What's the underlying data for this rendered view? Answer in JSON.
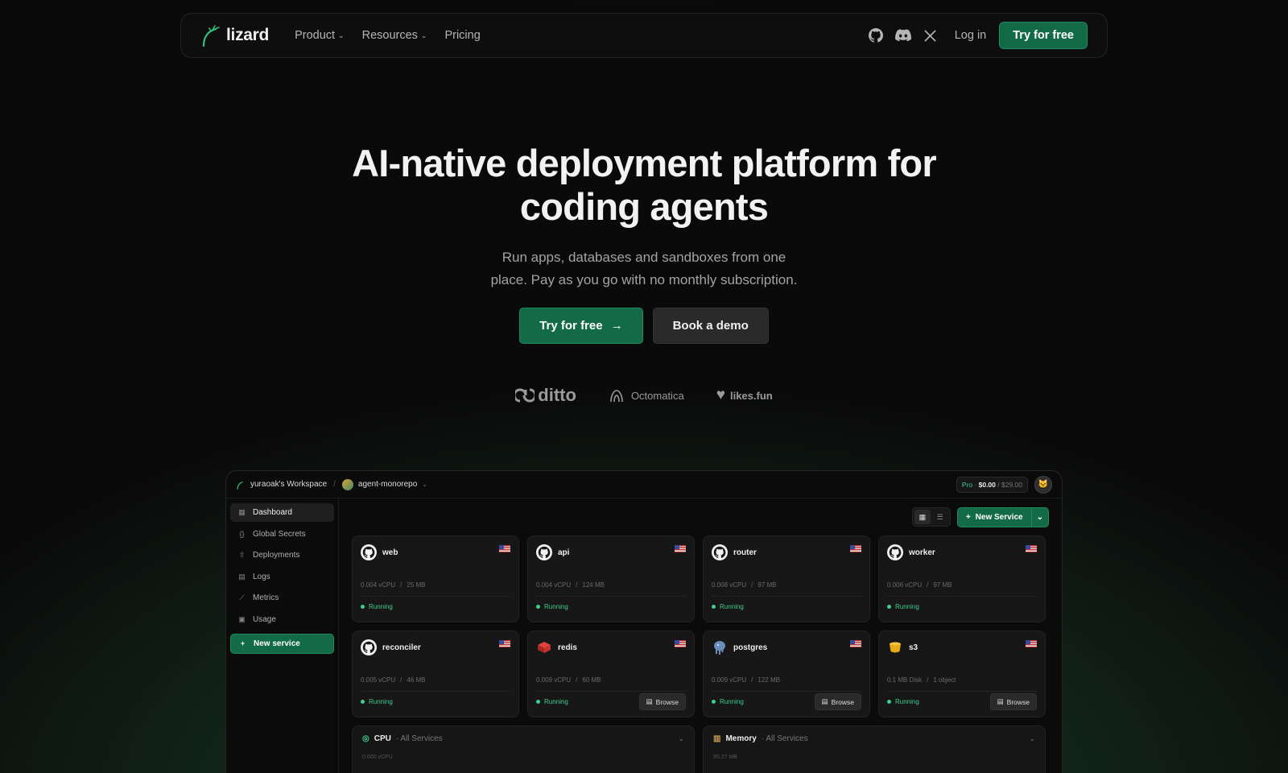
{
  "nav": {
    "brand": "lizard",
    "links": [
      {
        "label": "Product",
        "has_dropdown": true
      },
      {
        "label": "Resources",
        "has_dropdown": true
      },
      {
        "label": "Pricing",
        "has_dropdown": false
      }
    ],
    "icons": [
      "github-icon",
      "discord-icon",
      "x-icon"
    ],
    "login": "Log in",
    "cta": "Try for free"
  },
  "hero": {
    "title_line1": "AI-native deployment platform for",
    "title_line2": "coding agents",
    "subtitle_line1": "Run apps, databases and sandboxes from one",
    "subtitle_line2": "place. Pay as you go with no monthly subscription.",
    "primary": "Try for free",
    "secondary": "Book a demo"
  },
  "customers": [
    "ditto",
    "Octomatica",
    "likes.fun"
  ],
  "colors": {
    "accent": "#136a47",
    "running": "#3ecf8e",
    "background": "#0a0a0a"
  },
  "app": {
    "workspace": "yuraoak's Workspace",
    "project": "agent-monorepo",
    "plan": {
      "tier": "Pro",
      "spent": "$0.00",
      "limit": "/ $29.00"
    },
    "sidebar": [
      {
        "label": "Dashboard",
        "icon": "grid-icon",
        "active": true
      },
      {
        "label": "Global Secrets",
        "icon": "braces-icon",
        "active": false
      },
      {
        "label": "Deployments",
        "icon": "rocket-icon",
        "active": false
      },
      {
        "label": "Logs",
        "icon": "logs-icon",
        "active": false
      },
      {
        "label": "Metrics",
        "icon": "chart-icon",
        "active": false
      },
      {
        "label": "Usage",
        "icon": "usage-icon",
        "active": false
      }
    ],
    "sidebar_new": "New service",
    "new_service": "New Service",
    "services": [
      {
        "name": "web",
        "icon": "github-icon",
        "res1": "0.004 vCPU",
        "res2": "25 MB",
        "status": "Running",
        "browse": ""
      },
      {
        "name": "api",
        "icon": "github-icon",
        "res1": "0.004 vCPU",
        "res2": "124 MB",
        "status": "Running",
        "browse": ""
      },
      {
        "name": "router",
        "icon": "github-icon",
        "res1": "0.008 vCPU",
        "res2": "97 MB",
        "status": "Running",
        "browse": ""
      },
      {
        "name": "worker",
        "icon": "github-icon",
        "res1": "0.006 vCPU",
        "res2": "97 MB",
        "status": "Running",
        "browse": ""
      },
      {
        "name": "reconciler",
        "icon": "github-icon",
        "res1": "0.005 vCPU",
        "res2": "46 MB",
        "status": "Running",
        "browse": ""
      },
      {
        "name": "redis",
        "icon": "redis-icon",
        "res1": "0.009 vCPU",
        "res2": "60 MB",
        "status": "Running",
        "browse": "Browse"
      },
      {
        "name": "postgres",
        "icon": "postgres-icon",
        "res1": "0.009 vCPU",
        "res2": "122 MB",
        "status": "Running",
        "browse": "Browse"
      },
      {
        "name": "s3",
        "icon": "bucket-icon",
        "res1": "0.1 MB Disk",
        "res2": "1 object",
        "status": "Running",
        "browse": "Browse"
      }
    ],
    "panels": [
      {
        "title": "CPU",
        "scope": "· All Services",
        "value": "0.600 vCPU"
      },
      {
        "title": "Memory",
        "scope": "· All Services",
        "value": "95.27 MB"
      }
    ]
  }
}
